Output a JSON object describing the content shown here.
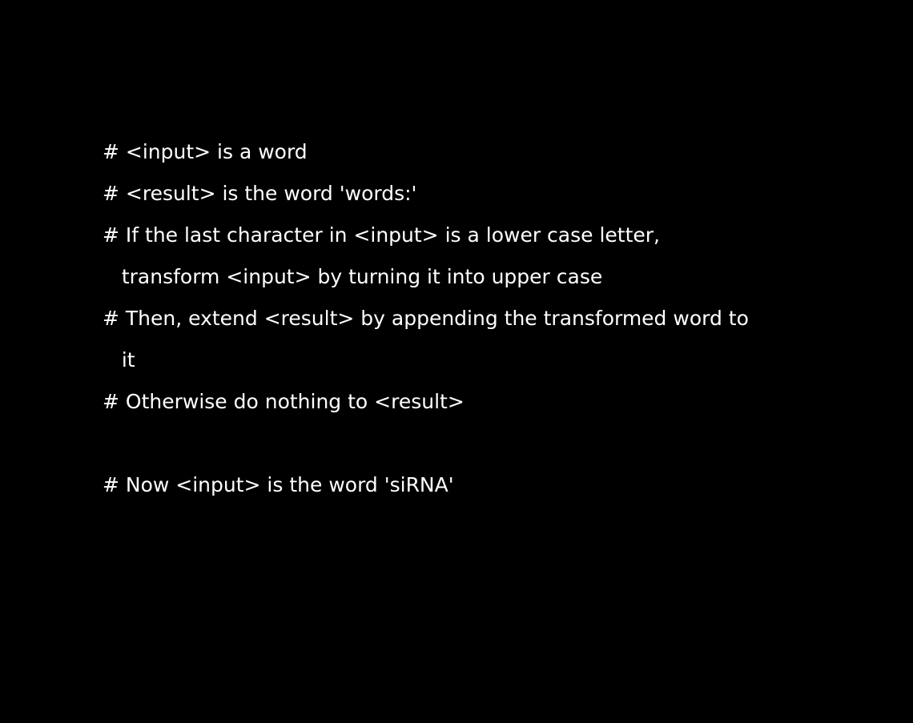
{
  "colors": {
    "background": "#000000",
    "text": "#ffffff"
  },
  "lines": [
    "# <input> is a word",
    "# <result> is the word 'words:'",
    "# If the last character in <input> is a lower case letter,",
    "   transform <input> by turning it into upper case",
    "# Then, extend <result> by appending the transformed word to",
    "   it",
    "# Otherwise do nothing to <result>",
    "",
    "# Now <input> is the word 'siRNA'"
  ]
}
